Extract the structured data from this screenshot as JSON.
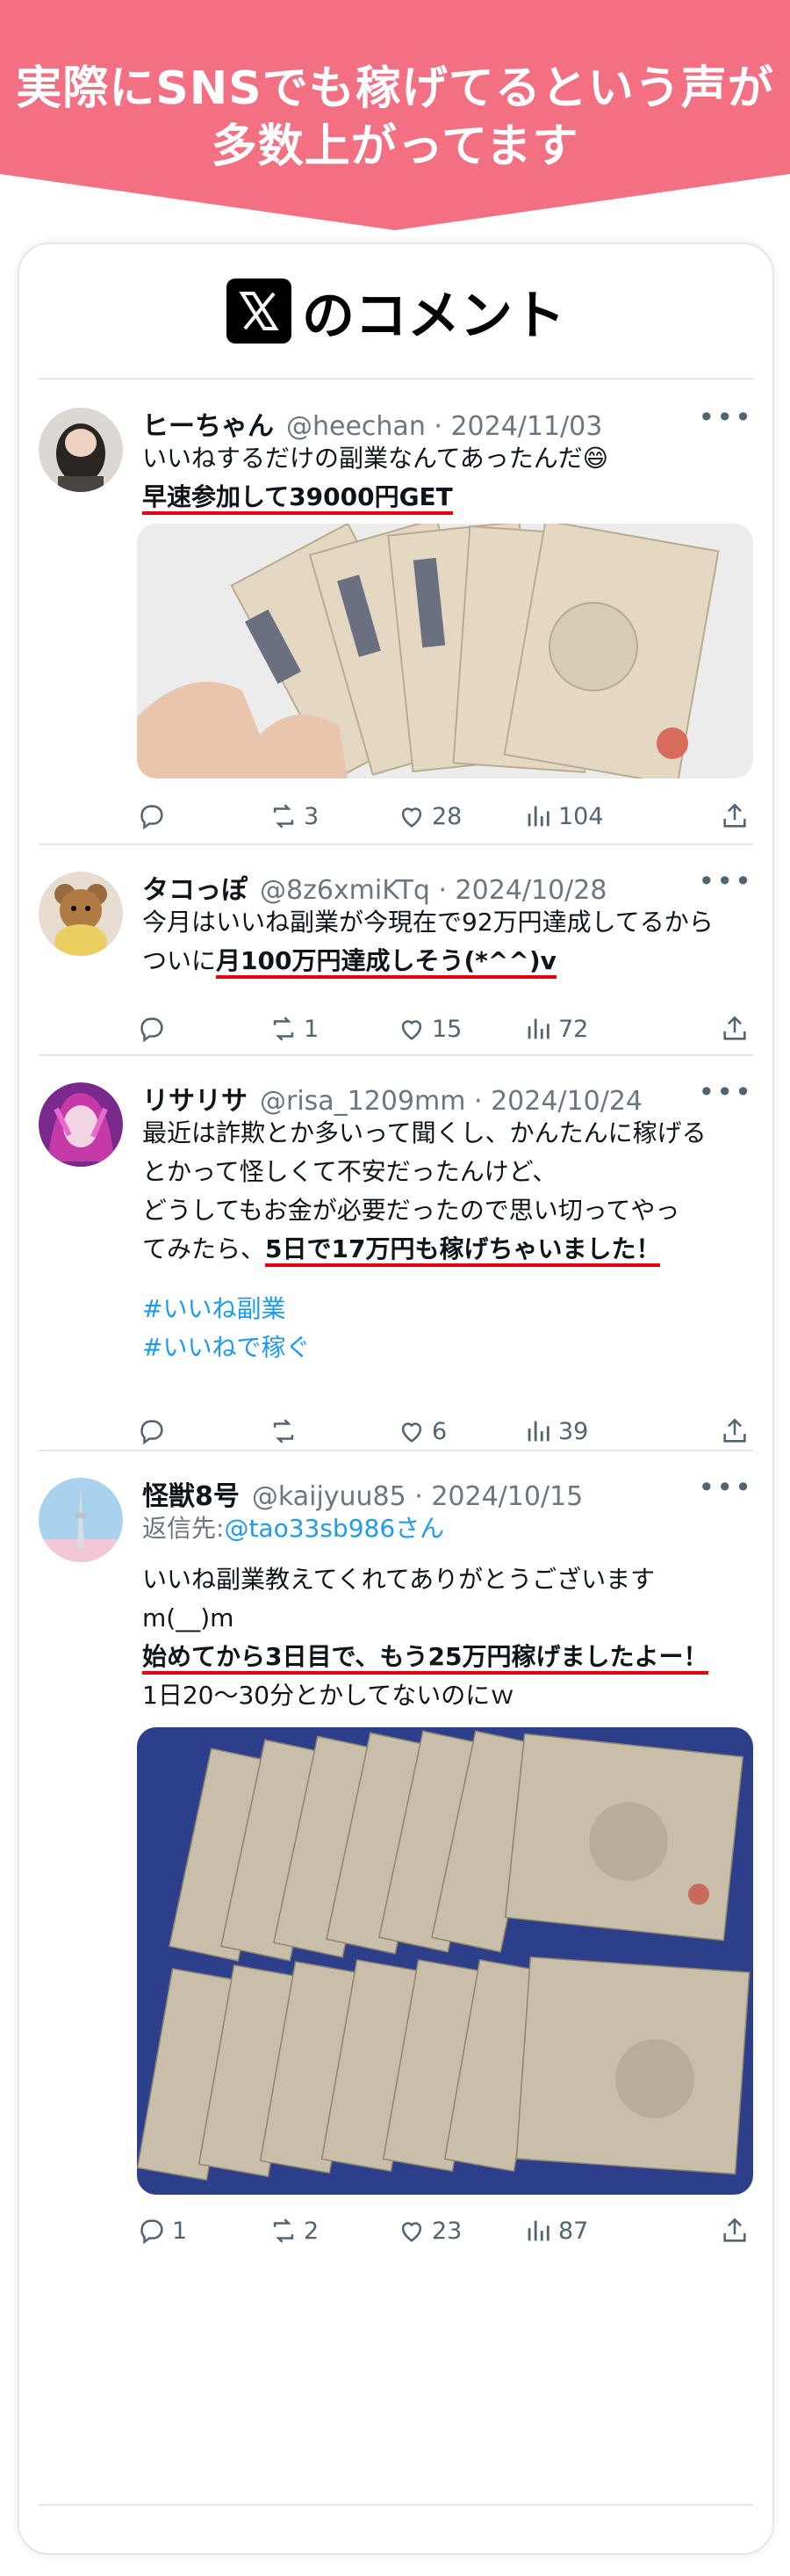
{
  "banner": {
    "line1": "実際にSNSでも稼げてるという声が",
    "line2": "多数上がってます"
  },
  "card": {
    "logo_icon": "x-logo-icon",
    "title": "のコメント"
  },
  "posts": [
    {
      "name": "ヒーちゃん",
      "meta": "@heechan · 2024/11/03",
      "text1": "いいねするだけの副業なんてあったんだ😄",
      "highlight": "早速参加して39000円GET",
      "photo": "yen-bills-fan-photo",
      "reply": "",
      "retweet": "3",
      "like": "28",
      "views": "104"
    },
    {
      "name": "タコっぽ",
      "meta": "@8z6xmiKTq · 2024/10/28",
      "text1": "今月はいいね副業が今現在で92万円達成してるから",
      "text2_pre": "ついに",
      "highlight": "月100万円達成しそう(*^^)v",
      "reply": "",
      "retweet": "1",
      "like": "15",
      "views": "72"
    },
    {
      "name": "リサリサ",
      "meta": "@risa_1209mm · 2024/10/24",
      "text1": "最近は詐欺とか多いって聞くし、かんたんに稼げる",
      "text2": "とかって怪しくて不安だったんけど、",
      "text3": "どうしてもお金が必要だったので思い切ってやっ",
      "text4_pre": "てみたら、",
      "highlight": "5日で17万円も稼げちゃいました！",
      "tag1": "#いいね副業",
      "tag2": "#いいねで稼ぐ",
      "reply": "",
      "retweet": "",
      "like": "6",
      "views": "39"
    },
    {
      "name": "怪獣8号",
      "meta": "@kaijyuu85 · 2024/10/15",
      "reply_label": "返信先:",
      "reply_handle": "@tao33sb986さん",
      "text1": "いいね副業教えてくれてありがとうございます",
      "text2": "m(__)m",
      "highlight": "始めてから3日目で、もう25万円稼げましたよー！",
      "text4": "1日20〜30分とかしてないのにｗ",
      "photo": "yen-bills-on-blanket-photo",
      "reply": "1",
      "retweet": "2",
      "like": "23",
      "views": "87"
    }
  ],
  "icons": {
    "reply": "reply-icon",
    "retweet": "retweet-icon",
    "like": "heart-icon",
    "views": "views-icon",
    "share": "share-icon",
    "more": "more-icon"
  },
  "colors": {
    "banner": "#f36f82",
    "underline": "#e60012",
    "hashtag": "#1d9bf0",
    "meta": "#6b7780"
  }
}
